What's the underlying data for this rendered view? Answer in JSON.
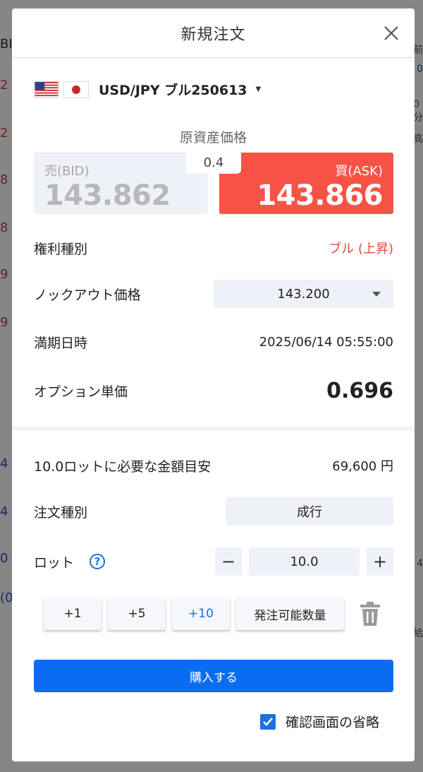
{
  "background": {
    "left_cells": [
      "BID",
      "2",
      "2",
      "8",
      "8",
      "9",
      "9",
      "4",
      "4",
      "0",
      "(0"
    ],
    "right_cells": [
      "前",
      "0",
      "0分",
      "高",
      "4",
      "給"
    ]
  },
  "modal": {
    "title": "新規注文",
    "symbol": "USD/JPY ブル250613",
    "price_section_title": "原資産価格",
    "spread": "0.4",
    "bid": {
      "label": "売(BID)",
      "value": "143.862"
    },
    "ask": {
      "label": "買(ASK)",
      "value": "143.866"
    },
    "right_type": {
      "label": "権利種別",
      "value": "ブル (上昇)"
    },
    "knockout": {
      "label": "ノックアウト価格",
      "value": "143.200"
    },
    "expiry": {
      "label": "満期日時",
      "value": "2025/06/14 05:55:00"
    },
    "option_price": {
      "label": "オプション単価",
      "value": "0.696"
    },
    "required_amount": {
      "label": "10.0ロットに必要な金額目安",
      "value": "69,600 円"
    },
    "order_type": {
      "label": "注文種別",
      "value": "成行"
    },
    "lot": {
      "label": "ロット",
      "value": "10.0",
      "minus": "−",
      "plus": "+"
    },
    "quick_buttons": [
      "+1",
      "+5",
      "+10",
      "発注可能数量"
    ],
    "buy_button": "購入する",
    "skip_confirm": "確認画面の省略"
  },
  "colors": {
    "ask_red": "#f65346",
    "primary_blue": "#0a6cf0",
    "bull_red": "#e8473b"
  }
}
